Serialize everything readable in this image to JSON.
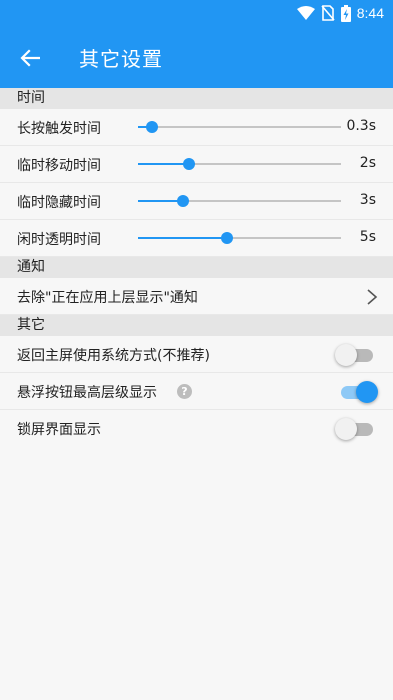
{
  "status_bar": {
    "time": "8:44"
  },
  "app_bar": {
    "title": "其它设置"
  },
  "sections": {
    "time": {
      "header": "时间",
      "sliders": [
        {
          "label": "长按触发时间",
          "value": "0.3s",
          "fraction": 0.07
        },
        {
          "label": "临时移动时间",
          "value": "2s",
          "fraction": 0.25
        },
        {
          "label": "临时隐藏时间",
          "value": "3s",
          "fraction": 0.22
        },
        {
          "label": "闲时透明时间",
          "value": "5s",
          "fraction": 0.44
        }
      ]
    },
    "notify": {
      "header": "通知",
      "item_label": "去除\"正在应用上层显示\"通知"
    },
    "other": {
      "header": "其它",
      "toggles": [
        {
          "label": "返回主屏使用系统方式(不推荐)",
          "on": false
        },
        {
          "label": "悬浮按钮最高层级显示",
          "on": true,
          "help": "?"
        },
        {
          "label": "锁屏界面显示",
          "on": false
        }
      ]
    }
  },
  "colors": {
    "accent": "#2196f3",
    "header_bg": "#e5e5e5",
    "page_bg": "#f7f7f7"
  }
}
